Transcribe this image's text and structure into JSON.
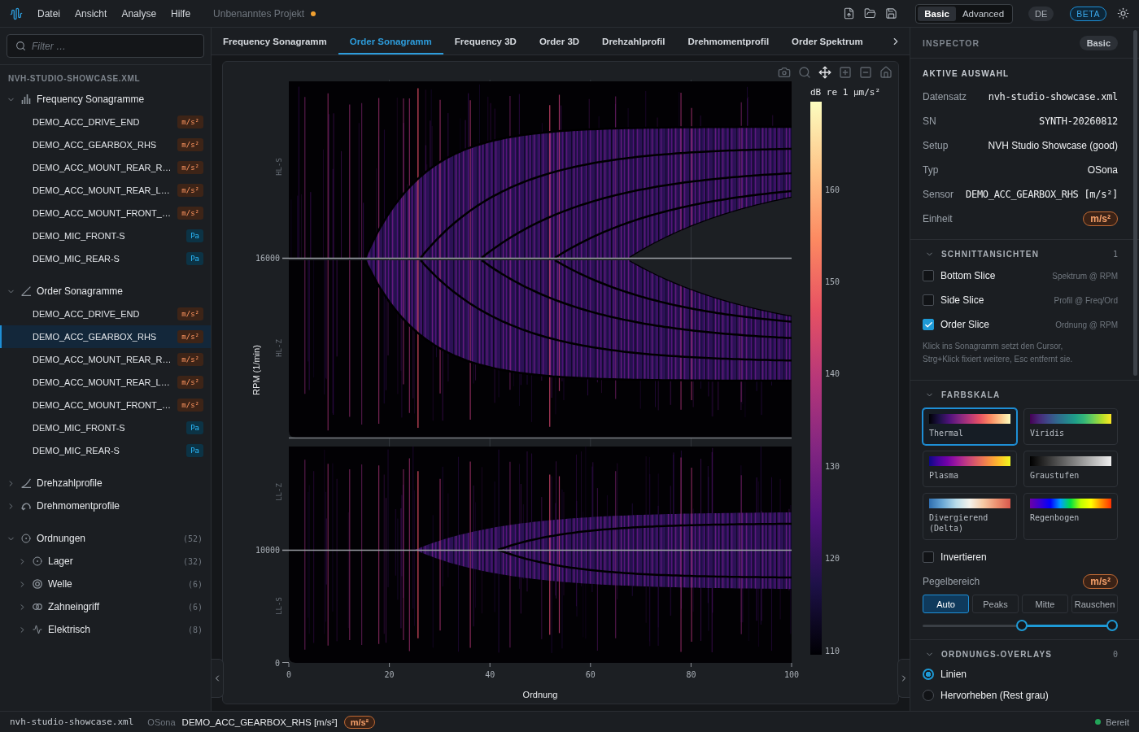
{
  "menu_bar": {
    "items": [
      "Datei",
      "Ansicht",
      "Analyse",
      "Hilfe"
    ],
    "project": "Unbenanntes Projekt",
    "unsaved": true
  },
  "mode_switch": [
    {
      "label": "Basic",
      "selected": true
    },
    {
      "label": "Advanced",
      "selected": false
    }
  ],
  "language": "DE",
  "badge": "BETA",
  "sidebar": {
    "filter": {
      "placeholder": "Filter …"
    },
    "title": "NVH-STUDIO-SHOWCASE.XML",
    "sections": [
      {
        "groups": [
          {
            "label": "Frequency Sonagramme",
            "kind": "spectrum",
            "expanded": true,
            "children": [
              {
                "kind": "channel",
                "label": "DEMO_ACC_DRIVE_END",
                "unit": "m/s²",
                "color": "#3d2417",
                "selected": false
              },
              {
                "kind": "channel",
                "label": "DEMO_ACC_GEARBOX_RHS",
                "unit": "m/s²",
                "color": "#3d2417",
                "selected": false
              },
              {
                "kind": "channel",
                "label": "DEMO_ACC_MOUNT_REAR_R…",
                "unit": "m/s²",
                "color": "#3d2417",
                "selected": false
              },
              {
                "kind": "channel",
                "label": "DEMO_ACC_MOUNT_REAR_L…",
                "unit": "m/s²",
                "color": "#3d2417",
                "selected": false
              },
              {
                "kind": "channel",
                "label": "DEMO_ACC_MOUNT_FRONT_…",
                "unit": "m/s²",
                "color": "#3d2417",
                "selected": false
              },
              {
                "kind": "channel",
                "label": "DEMO_MIC_FRONT-S",
                "unit": "Pa",
                "color": "#0c3345",
                "selected": false
              },
              {
                "kind": "channel",
                "label": "DEMO_MIC_REAR-S",
                "unit": "Pa",
                "color": "#0c3345",
                "selected": false
              }
            ]
          }
        ]
      },
      {
        "groups": [
          {
            "label": "Order Sonagramme",
            "kind": "order",
            "expanded": true,
            "children": [
              {
                "kind": "channel",
                "label": "DEMO_ACC_DRIVE_END",
                "unit": "m/s²",
                "color": "#3d2417",
                "selected": false
              },
              {
                "kind": "channel",
                "label": "DEMO_ACC_GEARBOX_RHS",
                "unit": "m/s²",
                "color": "#3d2417",
                "selected": true
              },
              {
                "kind": "channel",
                "label": "DEMO_ACC_MOUNT_REAR_R…",
                "unit": "m/s²",
                "color": "#3d2417",
                "selected": false
              },
              {
                "kind": "channel",
                "label": "DEMO_ACC_MOUNT_REAR_L…",
                "unit": "m/s²",
                "color": "#3d2417",
                "selected": false
              },
              {
                "kind": "channel",
                "label": "DEMO_ACC_MOUNT_FRONT_…",
                "unit": "m/s²",
                "color": "#3d2417",
                "selected": false
              },
              {
                "kind": "channel",
                "label": "DEMO_MIC_FRONT-S",
                "unit": "Pa",
                "color": "#0c3345",
                "selected": false
              },
              {
                "kind": "channel",
                "label": "DEMO_MIC_REAR-S",
                "unit": "Pa",
                "color": "#0c3345",
                "selected": false
              }
            ]
          }
        ]
      },
      {
        "groups": [
          {
            "label": "Drehzahlprofile",
            "kind": "speed",
            "expanded": false
          },
          {
            "label": "Drehmomentprofile",
            "kind": "torque",
            "expanded": false
          }
        ]
      },
      {
        "groups": [
          {
            "label": "Ordnungen",
            "kind": "orders",
            "expanded": true,
            "count": "(52)",
            "children": [
              {
                "label": "Lager",
                "kind": "bearing",
                "expanded": false,
                "count": "(32)"
              },
              {
                "label": "Welle",
                "kind": "shaft",
                "expanded": false,
                "count": "(6)"
              },
              {
                "label": "Zahneingriff",
                "kind": "gear",
                "expanded": false,
                "count": "(6)"
              },
              {
                "label": "Elektrisch",
                "kind": "electric",
                "expanded": false,
                "count": "(8)"
              }
            ]
          }
        ]
      }
    ]
  },
  "tabs": [
    {
      "label": "Frequency Sonagramm",
      "selected": false
    },
    {
      "label": "Order Sonagramm",
      "selected": true
    },
    {
      "label": "Frequency 3D",
      "selected": false
    },
    {
      "label": "Order 3D",
      "selected": false
    },
    {
      "label": "Drehzahlprofil",
      "selected": false
    },
    {
      "label": "Drehmomentprofil",
      "selected": false
    },
    {
      "label": "Order Spektrum",
      "selected": false
    }
  ],
  "plot": {
    "tools": [
      {
        "kind": "camera",
        "selected": false
      },
      {
        "kind": "zoom",
        "selected": false
      },
      {
        "kind": "pan",
        "selected": true
      },
      {
        "kind": "zoomin",
        "selected": false
      },
      {
        "kind": "zoomout",
        "selected": false
      },
      {
        "kind": "home",
        "selected": false
      }
    ],
    "subplots": [
      "HL-S",
      "HL-Z",
      "LL-Z",
      "LL-S"
    ],
    "y_title": "RPM (1/min)",
    "y_ticks": [
      "16000",
      "10000",
      "0"
    ],
    "x_title": "Ordnung",
    "x_ticks": [
      "0",
      "20",
      "40",
      "60",
      "80",
      "100"
    ],
    "colorbar": {
      "title": "dB re 1 µm/s²",
      "ticks": [
        "160",
        "150",
        "140",
        "130",
        "120",
        "110"
      ]
    }
  },
  "inspector": {
    "title": "INSPECTOR",
    "mode": "Basic",
    "selection": {
      "title": "AKTIVE AUSWAHL",
      "rows": [
        {
          "label": "Datensatz",
          "value": "nvh-studio-showcase.xml",
          "kind": "code"
        },
        {
          "label": "SN",
          "value": "SYNTH-20260812",
          "kind": "code"
        },
        {
          "label": "Setup",
          "value": "NVH Studio Showcase (good)",
          "kind": "text"
        },
        {
          "label": "Typ",
          "value": "OSona",
          "kind": "text"
        },
        {
          "label": "Sensor",
          "value": "DEMO_ACC_GEARBOX_RHS [m/s²]",
          "kind": "code"
        },
        {
          "label": "Einheit",
          "value": "m/s²",
          "kind": "unit"
        }
      ]
    },
    "slices": {
      "title": "SCHNITTANSICHTEN",
      "count": "1",
      "expanded": true,
      "items": [
        {
          "label": "Bottom Slice",
          "hint": "Spektrum @ RPM",
          "checked": false
        },
        {
          "label": "Side Slice",
          "hint": "Profil @ Freq/Ord",
          "checked": false
        },
        {
          "label": "Order Slice",
          "hint": "Ordnung @ RPM",
          "checked": true
        }
      ],
      "note": "Klick ins Sonagramm setzt den Cursor, Strg+Klick fixiert weitere, Esc entfernt sie."
    },
    "colorscale": {
      "title": "FARBSKALA",
      "expanded": true,
      "maps": [
        {
          "name": "Thermal",
          "kind": "thermal",
          "selected": true
        },
        {
          "name": "Viridis",
          "kind": "viridis",
          "selected": false
        },
        {
          "name": "Plasma",
          "kind": "plasma",
          "selected": false
        },
        {
          "name": "Graustufen",
          "kind": "gray",
          "selected": false
        },
        {
          "name": "Divergierend (Delta)",
          "kind": "diverging",
          "selected": false
        },
        {
          "name": "Regenbogen",
          "kind": "rainbow",
          "selected": false
        }
      ],
      "invert": {
        "label": "Invertieren",
        "checked": false
      },
      "range": {
        "label": "Pegelbereich",
        "unit": "m/s²",
        "presets": [
          {
            "label": "Auto",
            "selected": true
          },
          {
            "label": "Peaks",
            "selected": false
          },
          {
            "label": "Mitte",
            "selected": false
          },
          {
            "label": "Rauschen",
            "selected": false
          }
        ],
        "thumbs": [
          {
            "level": 0.51
          },
          {
            "level": 0.97
          }
        ]
      }
    },
    "overlays": {
      "title": "ORDNUNGS-OVERLAYS",
      "count": "0",
      "expanded": true,
      "options": [
        {
          "label": "Linien",
          "selected": true
        },
        {
          "label": "Hervorheben (Rest grau)",
          "selected": false
        }
      ]
    }
  },
  "status_bar": {
    "file": "nvh-studio-showcase.xml",
    "type": "OSona",
    "sensor": "DEMO_ACC_GEARBOX_RHS [m/s²]",
    "unit": "m/s²",
    "status": {
      "label": "Bereit",
      "color": "#22a559"
    }
  }
}
